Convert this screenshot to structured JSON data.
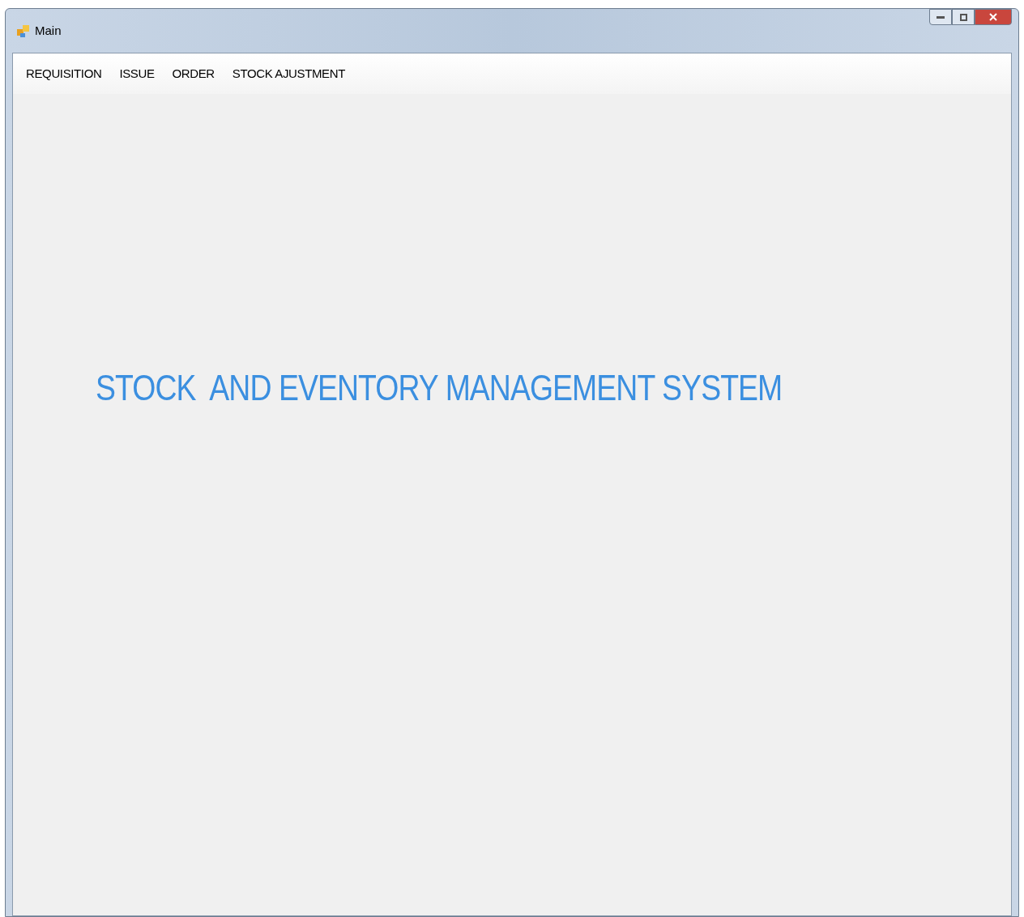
{
  "window": {
    "title": "Main"
  },
  "menu": [
    "REQUISITION",
    "ISSUE",
    "ORDER",
    "STOCK AJUSTMENT"
  ],
  "heading": "STOCK  AND EVENTORY MANAGEMENT SYSTEM"
}
